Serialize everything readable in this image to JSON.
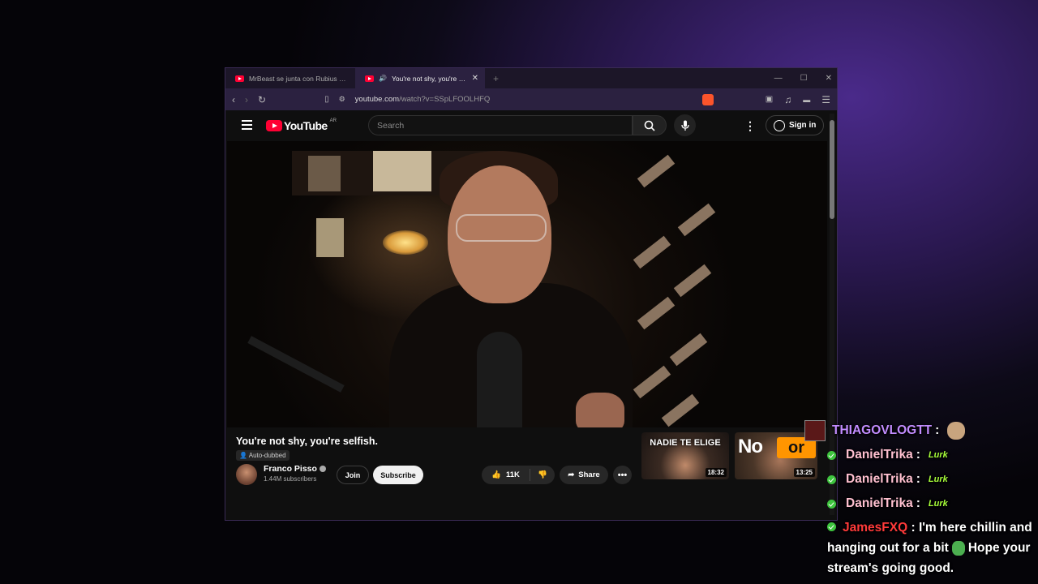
{
  "browser": {
    "tabs": [
      {
        "label": "MrBeast se junta con Rubius e Ibai",
        "active": false
      },
      {
        "label": "You're not shy, you're selfish.",
        "active": true
      }
    ],
    "new_tab": "+",
    "window_controls": {
      "minimize": "—",
      "maximize": "☐",
      "close": "✕"
    },
    "url_host": "youtube.com",
    "url_path": "/watch?v=SSpLFOOLHFQ"
  },
  "youtube": {
    "logo_text": "YouTube",
    "region": "AR",
    "search_placeholder": "Search",
    "sign_in": "Sign in",
    "video": {
      "title": "You're not shy, you're selfish.",
      "auto_dubbed": "Auto-dubbed",
      "channel": "Franco Pisso",
      "subscribers": "1.44M subscribers",
      "join": "Join",
      "subscribe": "Subscribe",
      "likes": "11K",
      "share": "Share"
    },
    "recommendations": [
      {
        "caption": "NADIE TE ELIGE",
        "duration": "18:32"
      },
      {
        "caption_a": "No",
        "caption_b": "or",
        "duration": "13:25"
      }
    ]
  },
  "chat": {
    "messages": [
      {
        "user": "THIAGOVLOGTT",
        "sep": ":",
        "text": ""
      },
      {
        "user": "DanielTrika",
        "sep": ":",
        "text": "Lurk"
      },
      {
        "user": "DanielTrika",
        "sep": ":",
        "text": "Lurk"
      },
      {
        "user": "DanielTrika",
        "sep": ":",
        "text": "Lurk"
      },
      {
        "user": "JamesFXQ",
        "sep": ":",
        "text_a": "I'm here chillin",
        "text_b": "and hanging out for a bit",
        "text_c": "Hope",
        "text_d": "your stream's going good."
      }
    ]
  },
  "colors": {
    "accent_brand": "#ff0033",
    "browser_chrome": "#2b2140",
    "chat_user_purple": "#c28cff",
    "chat_user_pink": "#ffc0d0",
    "chat_user_red": "#ff3a3a",
    "lurk_green": "#a8ff3a"
  }
}
